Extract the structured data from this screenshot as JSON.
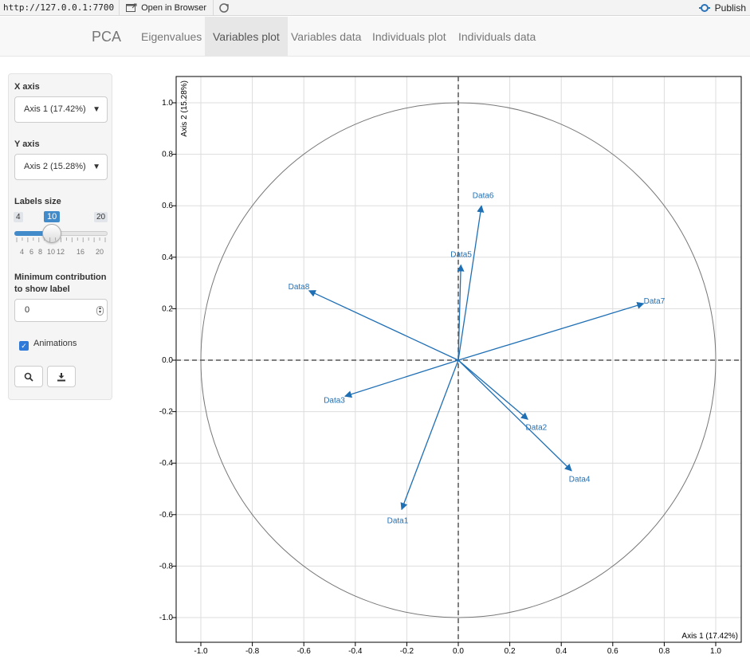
{
  "browser": {
    "url": "http://127.0.0.1:7700",
    "open_label": "Open in Browser",
    "publish_label": "Publish"
  },
  "navbar": {
    "brand": "PCA",
    "tabs": [
      {
        "label": "Eigenvalues",
        "active": false
      },
      {
        "label": "Variables plot",
        "active": true
      },
      {
        "label": "Variables data",
        "active": false
      },
      {
        "label": "Individuals plot",
        "active": false
      },
      {
        "label": "Individuals data",
        "active": false
      }
    ]
  },
  "sidebar": {
    "x_axis_label": "X axis",
    "x_axis_value": "Axis 1 (17.42%)",
    "y_axis_label": "Y axis",
    "y_axis_value": "Axis 2 (15.28%)",
    "labels_size_label": "Labels size",
    "slider": {
      "min": "4",
      "max": "20",
      "value": "10",
      "tick_labels": [
        "4",
        "6",
        "8",
        "10",
        "12",
        "16",
        "20"
      ]
    },
    "min_contrib_label_1": "Minimum contribution",
    "min_contrib_label_2": "to show label",
    "min_contrib_value": "0",
    "animations_label": "Animations",
    "animations_checked": true,
    "zoom_icon": "search-icon",
    "download_icon": "download-icon"
  },
  "chart_data": {
    "type": "scatter",
    "subtype": "pca-correlation-circle",
    "xlabel": "Axis 1 (17.42%)",
    "ylabel": "Axis 2 (15.28%)",
    "xlim": [
      -1.1,
      1.1
    ],
    "ylim": [
      -1.1,
      1.1
    ],
    "xticks": [
      "-1.0",
      "-0.8",
      "-0.6",
      "-0.4",
      "-0.2",
      "0.0",
      "0.2",
      "0.4",
      "0.6",
      "0.8",
      "1.0"
    ],
    "yticks": [
      "1.0",
      "0.8",
      "0.6",
      "0.4",
      "0.2",
      "0.0",
      "-0.2",
      "-0.4",
      "-0.6",
      "-0.8",
      "-1.0"
    ],
    "grid": true,
    "unit_circle": true,
    "arrow_color": "#1f6fb5",
    "variables": [
      {
        "name": "Data1",
        "x": -0.22,
        "y": -0.58
      },
      {
        "name": "Data2",
        "x": 0.27,
        "y": -0.23
      },
      {
        "name": "Data3",
        "x": -0.44,
        "y": -0.14
      },
      {
        "name": "Data4",
        "x": 0.44,
        "y": -0.43
      },
      {
        "name": "Data5",
        "x": 0.01,
        "y": 0.37
      },
      {
        "name": "Data6",
        "x": 0.09,
        "y": 0.6
      },
      {
        "name": "Data7",
        "x": 0.72,
        "y": 0.22
      },
      {
        "name": "Data8",
        "x": -0.58,
        "y": 0.27
      }
    ]
  }
}
